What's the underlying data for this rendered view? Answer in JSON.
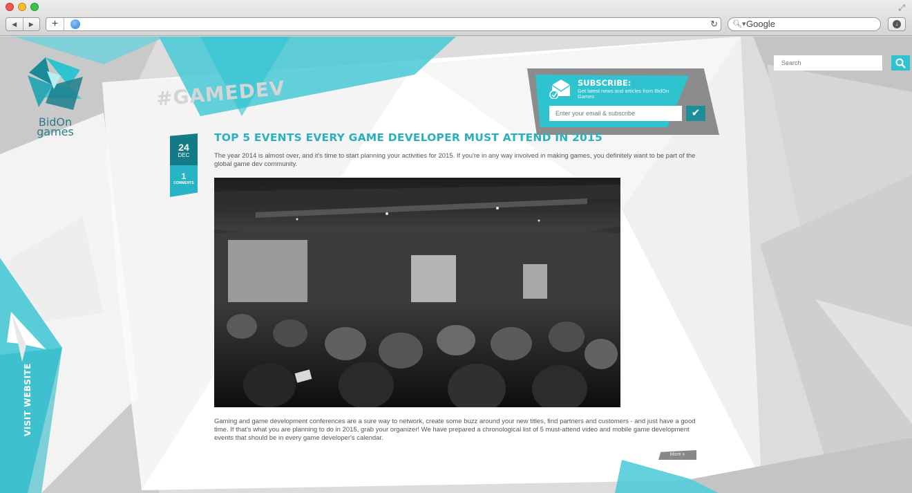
{
  "browser": {
    "nav_back": "◀",
    "nav_forward": "▶",
    "new_tab": "+",
    "reload": "↻",
    "search_engine": "Google"
  },
  "site": {
    "logo_line1": "BidOn",
    "logo_line2": "games",
    "hashtag": "#GAMEDEV",
    "search_placeholder": "Search",
    "visit_website": "VISIT WEBSITE",
    "accent": "#2fc3d0",
    "accent_dark": "#147a87"
  },
  "subscribe": {
    "title": "SUBSCRIBE:",
    "description": "Get latest news and articles from BidOn Games",
    "email_placeholder": "Enter your email & subscribe",
    "submit_icon": "✔"
  },
  "post": {
    "day": "24",
    "month": "DEC",
    "comment_count": "1",
    "comment_label": "COMMENTS",
    "title": "TOP 5 EVENTS EVERY GAME DEVELOPER MUST ATTEND IN 2015",
    "intro": "The year 2014 is almost over, and it's time to start planning your activities for 2015. If you're in any way involved in making games, you definitely want to be part of the global game dev community.",
    "body": "Gaming and game development conferences are a sure way to network, create some buzz around your new titles, find partners and customers - and just have a good time. If that's what you are planning to do in 2015, grab your organizer! We have prepared a chronological list of 5 must-attend video and mobile game development events that should be in every game developer's calendar.",
    "more": "More  »"
  }
}
